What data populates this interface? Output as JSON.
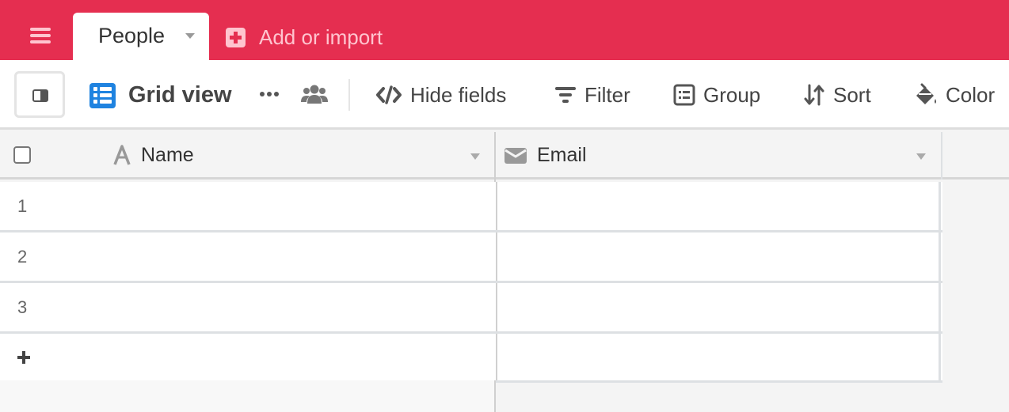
{
  "topbar": {
    "menu_icon": "hamburger-icon",
    "active_tab": {
      "label": "People",
      "icon": "caret-down-icon"
    },
    "add_import": {
      "label": "Add or import",
      "icon": "plus-square-icon"
    },
    "colors": {
      "background": "#e52e50",
      "muted_text": "#ffc4cf"
    }
  },
  "toolbar": {
    "sidebar_toggle_icon": "sidebar-toggle-icon",
    "view": {
      "label": "Grid view",
      "icon": "grid-view-icon",
      "icon_color": "#1f83e0"
    },
    "more_icon": "ellipsis-icon",
    "share_icon": "people-icon",
    "actions": [
      {
        "label": "Hide fields",
        "icon": "hide-fields-icon"
      },
      {
        "label": "Filter",
        "icon": "filter-icon"
      },
      {
        "label": "Group",
        "icon": "group-icon"
      },
      {
        "label": "Sort",
        "icon": "sort-icon"
      },
      {
        "label": "Color",
        "icon": "paint-bucket-icon"
      }
    ]
  },
  "grid": {
    "columns": [
      {
        "label": "Name",
        "icon": "text-field-icon"
      },
      {
        "label": "Email",
        "icon": "envelope-icon"
      }
    ],
    "rows": [
      {
        "number": "1",
        "name": "",
        "email": ""
      },
      {
        "number": "2",
        "name": "",
        "email": ""
      },
      {
        "number": "3",
        "name": "",
        "email": ""
      }
    ],
    "add_row_icon": "plus-icon"
  }
}
